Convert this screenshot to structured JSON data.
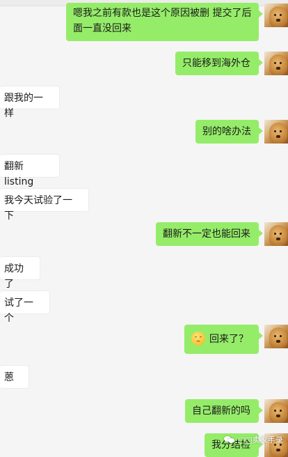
{
  "messages": [
    {
      "sender": "me",
      "lines": [
        "嗯我之前有款也是这个原因被删 提交了后",
        "面一直没回来"
      ]
    },
    {
      "sender": "me",
      "text": "只能移到海外仓"
    },
    {
      "sender": "them",
      "text": "跟我的一样"
    },
    {
      "sender": "me",
      "text": "别的啥办法"
    },
    {
      "sender": "them",
      "text": "翻新listing"
    },
    {
      "sender": "them",
      "text": "我今天试验了一下"
    },
    {
      "sender": "me",
      "text": "翻新不一定也能回来"
    },
    {
      "sender": "them",
      "text": "成功了"
    },
    {
      "sender": "them",
      "text": "试了一个"
    },
    {
      "sender": "me",
      "emoji": "worried-face-icon",
      "text": "回来了？"
    },
    {
      "sender": "them",
      "text": "蒽"
    },
    {
      "sender": "me",
      "text": "自己翻新的吗"
    },
    {
      "sender": "me",
      "text": "我分结检"
    }
  ],
  "watermark": "□□卖家手录"
}
